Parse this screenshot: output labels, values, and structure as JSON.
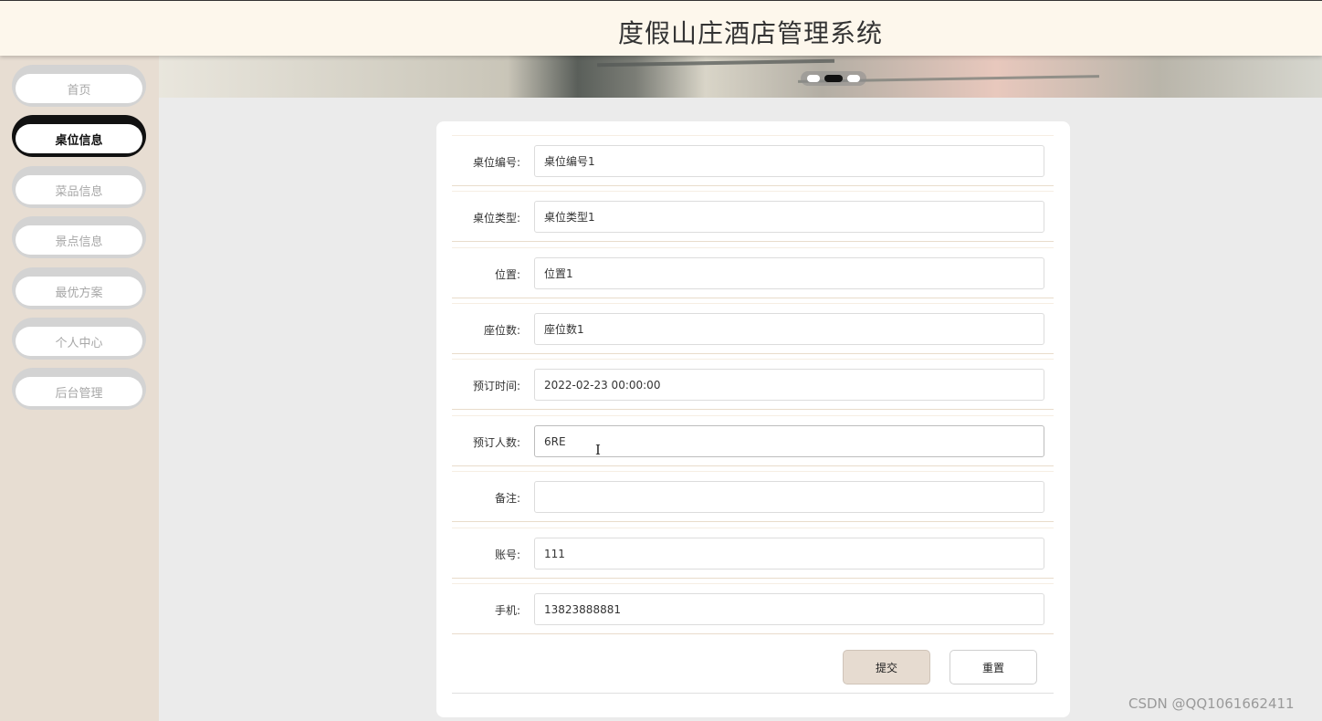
{
  "header": {
    "title": "度假山庄酒店管理系统"
  },
  "sidebar": {
    "items": [
      {
        "label": "首页",
        "active": false
      },
      {
        "label": "桌位信息",
        "active": true
      },
      {
        "label": "菜品信息",
        "active": false
      },
      {
        "label": "景点信息",
        "active": false
      },
      {
        "label": "最优方案",
        "active": false
      },
      {
        "label": "个人中心",
        "active": false
      },
      {
        "label": "后台管理",
        "active": false
      }
    ]
  },
  "banner": {
    "slide_count": 3,
    "active_slide": 2
  },
  "form": {
    "fields": [
      {
        "label": "桌位编号:",
        "value": "桌位编号1"
      },
      {
        "label": "桌位类型:",
        "value": "桌位类型1"
      },
      {
        "label": "位置:",
        "value": "位置1"
      },
      {
        "label": "座位数:",
        "value": "座位数1"
      },
      {
        "label": "预订时间:",
        "value": "2022-02-23 00:00:00"
      },
      {
        "label": "预订人数:",
        "value": "6RE"
      },
      {
        "label": "备注:",
        "value": ""
      },
      {
        "label": "账号:",
        "value": "111"
      },
      {
        "label": "手机:",
        "value": "13823888881"
      }
    ],
    "submit_label": "提交",
    "reset_label": "重置"
  },
  "watermark": "CSDN @QQ1061662411",
  "colors": {
    "header_bg": "#fdf7ec",
    "sidebar_bg": "#e7ddd2",
    "page_bg": "#ebebeb",
    "submit_bg": "#e6dbd0"
  }
}
